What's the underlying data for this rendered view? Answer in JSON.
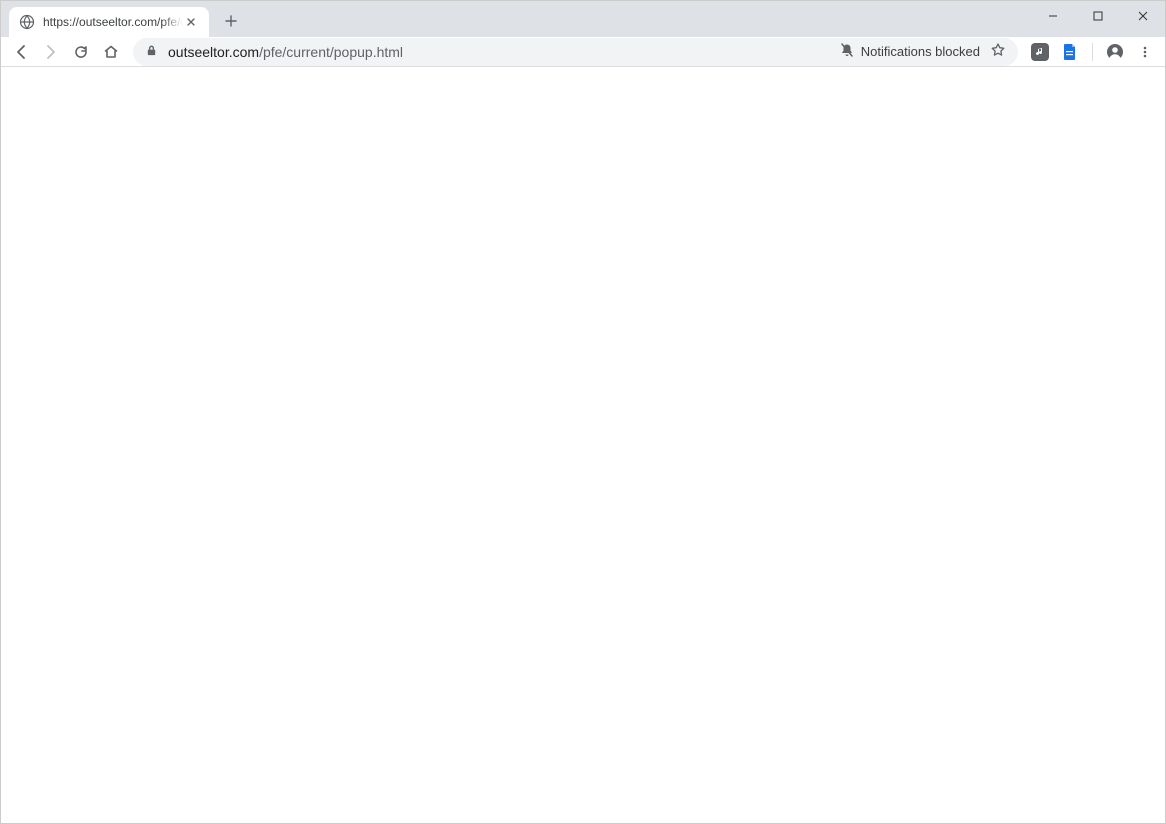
{
  "tab": {
    "title": "https://outseeltor.com/pfe/current/popup.html"
  },
  "url": {
    "domain": "outseeltor.com",
    "path": "/pfe/current/popup.html"
  },
  "omnibox": {
    "notification_text": "Notifications blocked"
  },
  "icons": {
    "globe": "globe-icon",
    "close": "close-icon",
    "plus": "plus-icon",
    "back": "back-icon",
    "forward": "forward-icon",
    "reload": "reload-icon",
    "home": "home-icon",
    "lock": "lock-icon",
    "bell_off": "notification-off-icon",
    "star": "star-icon",
    "profile": "profile-icon",
    "menu": "menu-icon",
    "minimize": "minimize-icon",
    "maximize": "maximize-icon",
    "window_close": "window-close-icon"
  }
}
